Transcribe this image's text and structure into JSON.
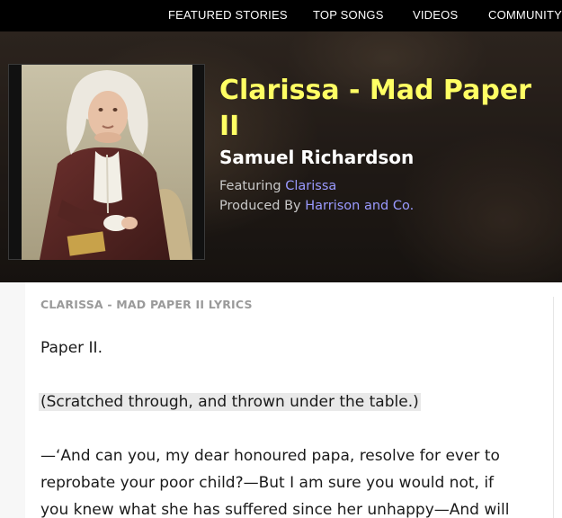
{
  "nav": {
    "items": [
      {
        "label": "FEATURED STORIES"
      },
      {
        "label": "TOP SONGS"
      },
      {
        "label": "VIDEOS"
      },
      {
        "label": "COMMUNITY"
      }
    ]
  },
  "hero": {
    "cover_icon": "portrait-image",
    "title_line1": "Clarissa - Mad Paper",
    "title_line2": "II",
    "artist": "Samuel Richardson",
    "featuring_label": "Featuring",
    "featuring_value": "Clarissa",
    "produced_label": "Produced By",
    "produced_value": "Harrison and Co.",
    "title_color": "#ffff64",
    "link_color": "#9a9aff"
  },
  "lyrics": {
    "heading": "CLARISSA - MAD PAPER II LYRICS",
    "lines": [
      "Paper II.",
      "(Scratched through, and thrown under the table.)",
      "—‘And can you, my dear honoured papa, resolve for ever to",
      "reprobate your poor child?—But I am sure you would not, if",
      "you knew what she has suffered since her unhappy—And will"
    ]
  }
}
